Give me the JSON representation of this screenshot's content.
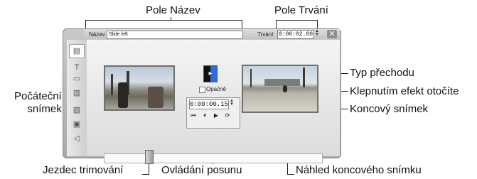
{
  "callouts": {
    "name_field": "Pole Název",
    "duration_field": "Pole Trvání",
    "transition_type": "Typ přechodu",
    "click_reverse": "Klepnutím efekt otočíte",
    "end_frame": "Koncový snímek",
    "start_frame_line1": "Počáteční",
    "start_frame_line2": "snímek",
    "trim_slider": "Jezdec trimování",
    "shuttle_controls": "Ovládání posunu",
    "end_preview": "Náhled koncového snímku"
  },
  "editor": {
    "name_label": "Název",
    "name_value": "Slide left",
    "duration_label": "Trvání",
    "duration_value": "0:00:02.00",
    "reverse_label": "Opačně",
    "position_value": "0:00:00.15",
    "close_symbol": "✕",
    "buttons": {
      "go_start": "⏮",
      "step_back": "⏴",
      "play": "▶",
      "loop": "⟳"
    },
    "sidebar_icons": [
      "video-clip-icon",
      "title-icon",
      "text-icon",
      "effects-icon",
      "transition-icon",
      "settings-icon",
      "audio-icon"
    ]
  }
}
